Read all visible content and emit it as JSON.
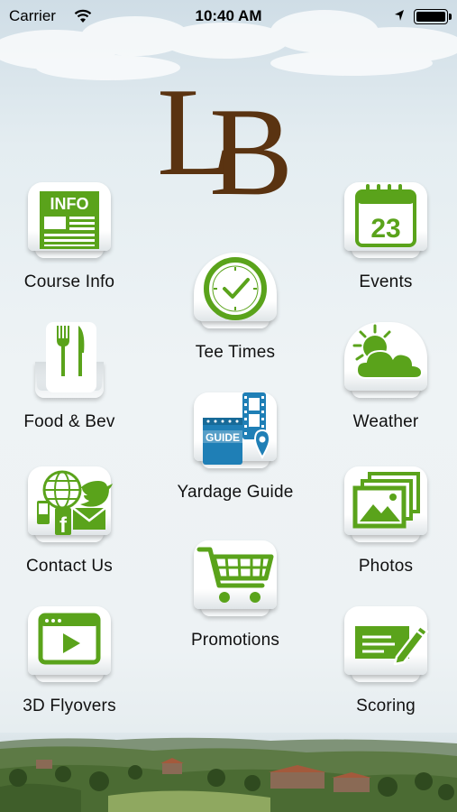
{
  "status_bar": {
    "carrier": "Carrier",
    "time": "10:40 AM",
    "wifi_icon": "wifi-icon",
    "location_icon": "location-arrow-icon",
    "battery_icon": "battery-full-icon"
  },
  "logo": {
    "text": "LB"
  },
  "tiles": [
    {
      "label": "Course Info",
      "icon": "info-newspaper-icon",
      "icon_text": "INFO"
    },
    {
      "label": "Events",
      "icon": "calendar-icon",
      "icon_text": "23"
    },
    {
      "label": "Tee Times",
      "icon": "clock-icon"
    },
    {
      "label": "Food & Bev",
      "icon": "fork-knife-icon"
    },
    {
      "label": "Weather",
      "icon": "sun-cloud-icon"
    },
    {
      "label": "Yardage Guide",
      "icon": "guide-map-icon",
      "icon_text": "GUIDE"
    },
    {
      "label": "Contact Us",
      "icon": "contact-social-icon"
    },
    {
      "label": "Photos",
      "icon": "photos-icon"
    },
    {
      "label": "Promotions",
      "icon": "shopping-cart-icon"
    },
    {
      "label": "3D Flyovers",
      "icon": "video-player-icon"
    },
    {
      "label": "Scoring",
      "icon": "scorecard-pencil-icon"
    }
  ],
  "colors": {
    "accent_green": "#5aa31b",
    "logo_brown": "#5a3311",
    "guide_blue": "#1f7fb6"
  }
}
